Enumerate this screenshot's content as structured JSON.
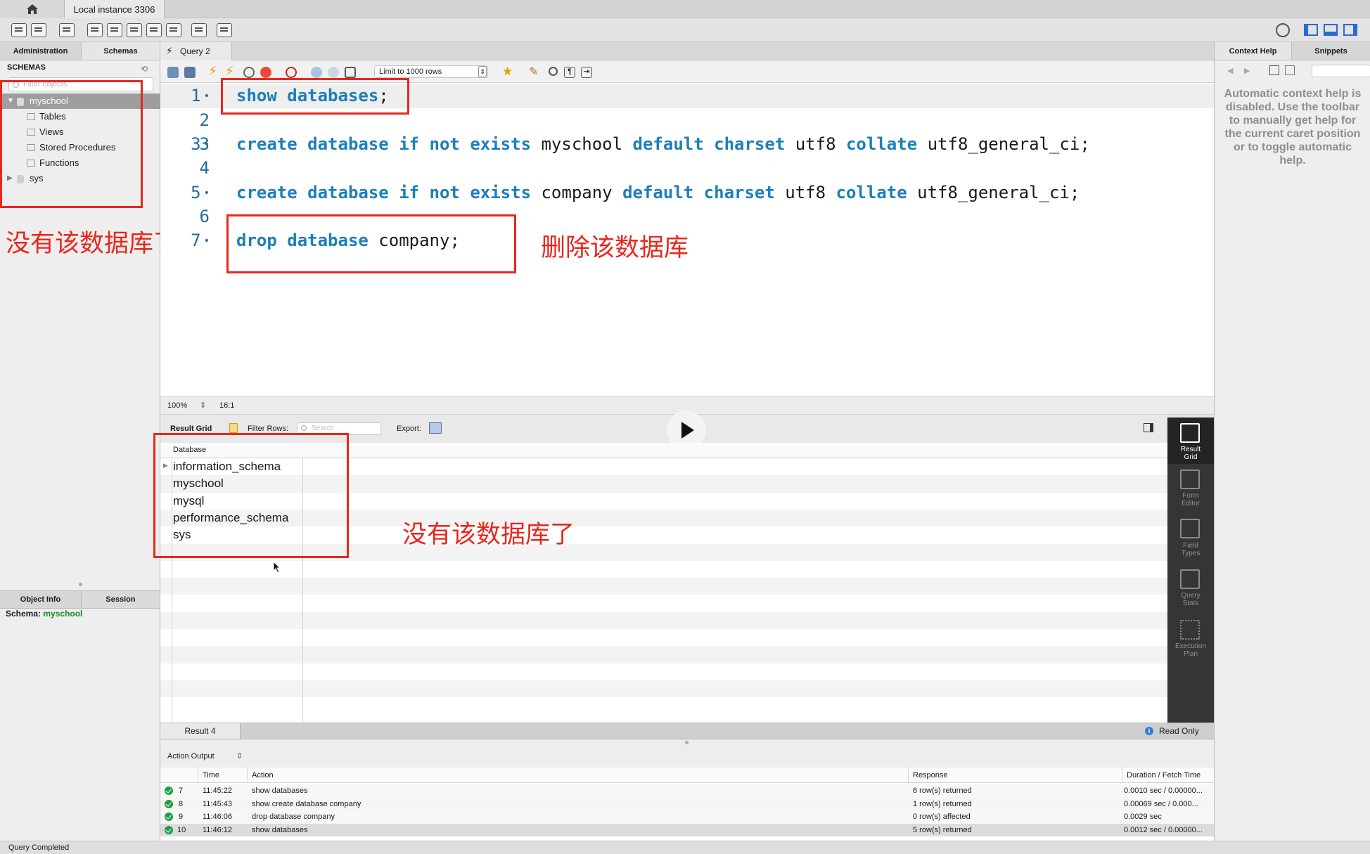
{
  "window": {
    "instance_tab": "Local instance 3306"
  },
  "left_panel": {
    "tabs": [
      "Administration",
      "Schemas"
    ],
    "schemas_header": "SCHEMAS",
    "filter_placeholder": "Filter objects",
    "tree": {
      "schema1": "myschool",
      "children": [
        "Tables",
        "Views",
        "Stored Procedures",
        "Functions"
      ],
      "schema2": "sys"
    },
    "annotation": "没有该数据库了",
    "info_tabs": [
      "Object Info",
      "Session"
    ],
    "schema_label": "Schema:",
    "schema_value": "myschool"
  },
  "editor": {
    "tab_label": "Query 2",
    "limit_select": "Limit to 1000 rows",
    "line_numbers": [
      "1",
      "2",
      "3",
      "4",
      "5",
      "6",
      "7"
    ],
    "line_marker": "•",
    "lines": {
      "l1": [
        {
          "t": "show databases",
          "k": true
        },
        {
          "t": ";",
          "k": false
        }
      ],
      "l3": [
        {
          "t": "create database if not exists",
          "k": true
        },
        {
          "t": " myschool ",
          "k": false
        },
        {
          "t": "default charset",
          "k": true
        },
        {
          "t": " utf8 ",
          "k": false
        },
        {
          "t": "collate",
          "k": true
        },
        {
          "t": " utf8_general_ci;",
          "k": false
        }
      ],
      "l5": [
        {
          "t": "create database if not exists",
          "k": true
        },
        {
          "t": " company ",
          "k": false
        },
        {
          "t": "default charset",
          "k": true
        },
        {
          "t": " utf8 ",
          "k": false
        },
        {
          "t": "collate",
          "k": true
        },
        {
          "t": " utf8_general_ci;",
          "k": false
        }
      ],
      "l7": [
        {
          "t": "drop database",
          "k": true
        },
        {
          "t": " company;",
          "k": false
        }
      ]
    },
    "annotation": "删除该数据库",
    "zoom": "100%",
    "cursor_pos": "16:1"
  },
  "results": {
    "grid_tab": "Result Grid",
    "filter_label": "Filter Rows:",
    "search_placeholder": "Search",
    "export_label": "Export:",
    "column": "Database",
    "rows": [
      "information_schema",
      "myschool",
      "mysql",
      "performance_schema",
      "sys"
    ],
    "annotation": "没有该数据库了",
    "side_tabs": [
      {
        "l1": "Result",
        "l2": "Grid"
      },
      {
        "l1": "Form",
        "l2": "Editor"
      },
      {
        "l1": "Field",
        "l2": "Types"
      },
      {
        "l1": "Query",
        "l2": "Stats"
      },
      {
        "l1": "Execution",
        "l2": "Plan"
      }
    ],
    "result_tab": "Result 4",
    "read_only": "Read Only"
  },
  "output": {
    "selector": "Action Output",
    "columns": [
      "Time",
      "Action",
      "Response",
      "Duration / Fetch Time"
    ],
    "rows": [
      {
        "n": "7",
        "time": "11:45:22",
        "action": "show databases",
        "response": "6 row(s) returned",
        "duration": "0.0010 sec / 0.00000..."
      },
      {
        "n": "8",
        "time": "11:45:43",
        "action": "show create database company",
        "response": "1 row(s) returned",
        "duration": "0.00069 sec / 0.000..."
      },
      {
        "n": "9",
        "time": "11:46:06",
        "action": "drop database company",
        "response": "0 row(s) affected",
        "duration": "0.0029 sec"
      },
      {
        "n": "10",
        "time": "11:46:12",
        "action": "show databases",
        "response": "5 row(s) returned",
        "duration": "0.0012 sec / 0.00000..."
      }
    ]
  },
  "right_panel": {
    "tabs": [
      "Context Help",
      "Snippets"
    ],
    "help_text": "Automatic context help is disabled. Use the toolbar to manually get help for the current caret position or to toggle automatic help."
  },
  "status_bar": "Query Completed",
  "colors": {
    "annotation_red": "#e8271d",
    "keyword_blue": "#1d7fb8",
    "success_green": "#1d9f43"
  }
}
